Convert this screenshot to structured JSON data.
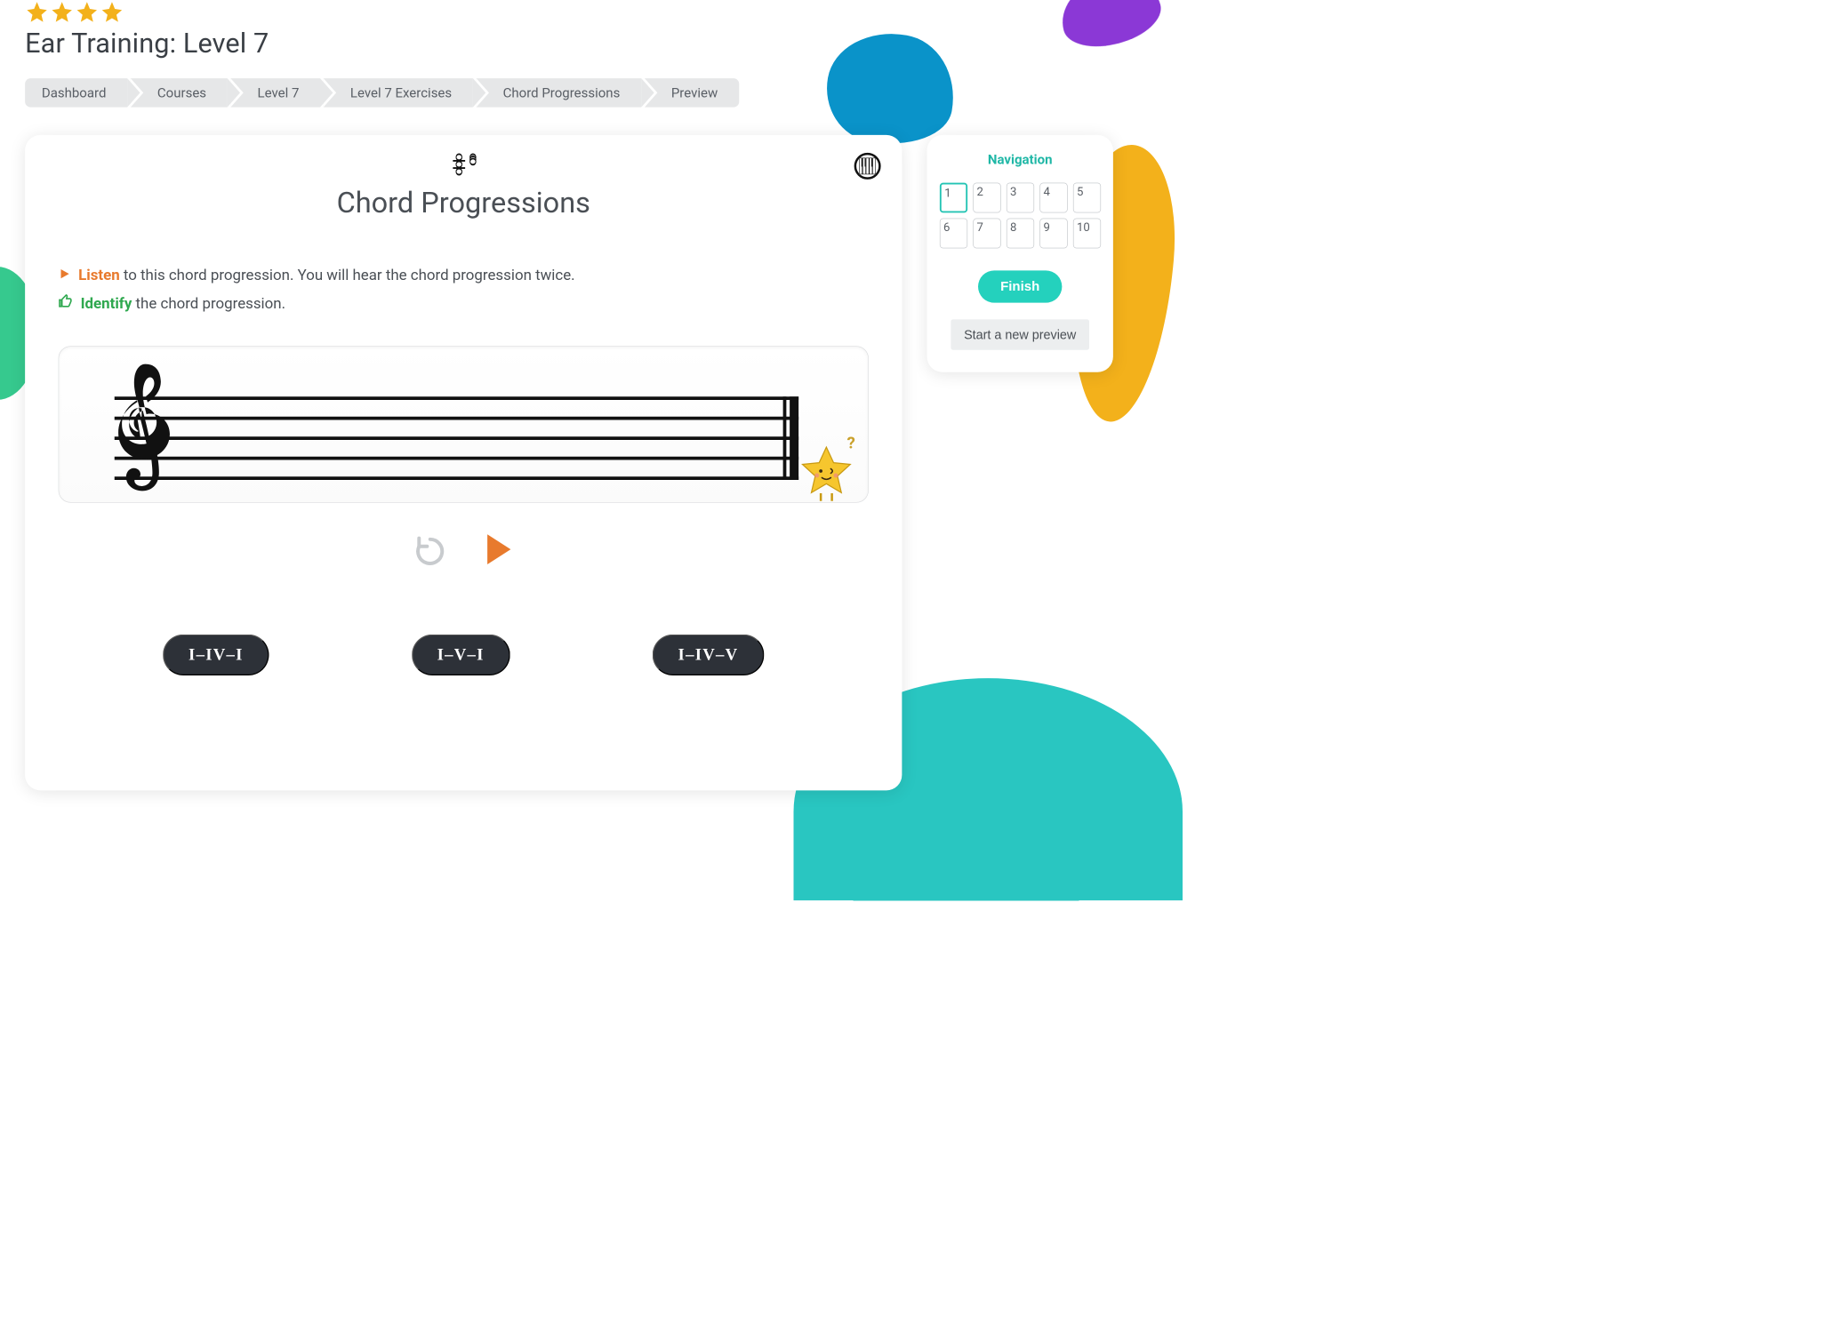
{
  "header": {
    "star_count": 4,
    "title": "Ear Training: Level 7"
  },
  "breadcrumb": [
    "Dashboard",
    "Courses",
    "Level 7",
    "Level 7 Exercises",
    "Chord Progressions",
    "Preview"
  ],
  "exercise": {
    "title": "Chord Progressions",
    "instr1_word": "Listen",
    "instr1_rest": " to this chord progression. You will hear the chord progression twice.",
    "instr2_word": "Identify",
    "instr2_rest": " the chord progression."
  },
  "answers": [
    "I–IV–I",
    "I–V–I",
    "I–IV–V"
  ],
  "navigation": {
    "title": "Navigation",
    "cells": [
      "1",
      "2",
      "3",
      "4",
      "5",
      "6",
      "7",
      "8",
      "9",
      "10"
    ],
    "active_index": 0,
    "finish_label": "Finish",
    "new_preview_label": "Start a new preview"
  }
}
